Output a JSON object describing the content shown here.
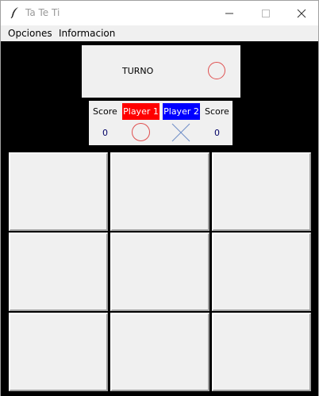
{
  "window": {
    "title": "Ta Te Ti",
    "icon": "feather-icon",
    "controls": [
      "minimize-icon",
      "maximize-icon",
      "close-icon"
    ]
  },
  "menu": {
    "items": [
      {
        "label": "Opciones"
      },
      {
        "label": "Informacion"
      }
    ]
  },
  "turn": {
    "label": "TURNO",
    "current_symbol": "circle-icon",
    "symbol_color": "#e05050"
  },
  "scoreboard": {
    "score_label_left": "Score",
    "score_label_right": "Score",
    "player1": {
      "name": "Player 1",
      "score": "0",
      "symbol": "circle-icon",
      "color": "#ff0000"
    },
    "player2": {
      "name": "Player 2",
      "score": "0",
      "symbol": "cross-icon",
      "color": "#0000ff"
    }
  },
  "board": {
    "cells": [
      "",
      "",
      "",
      "",
      "",
      "",
      "",
      "",
      ""
    ]
  }
}
